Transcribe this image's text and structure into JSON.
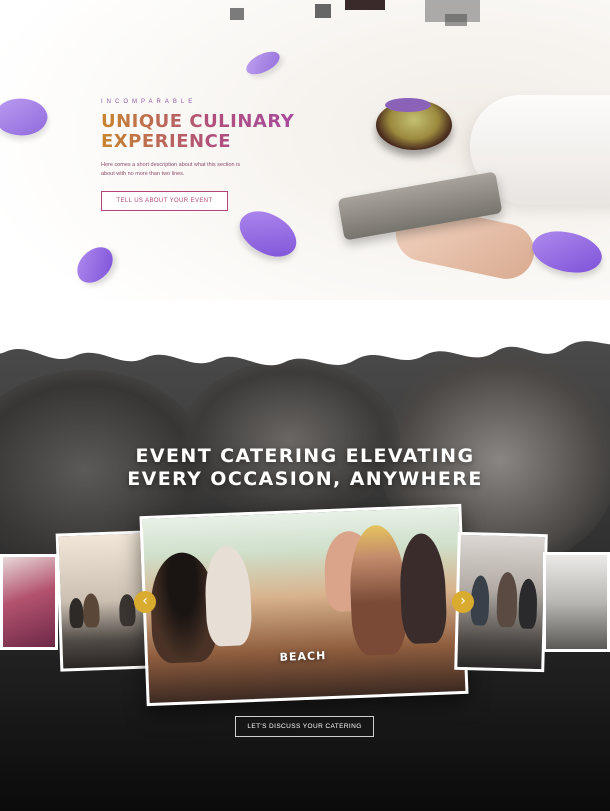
{
  "hero": {
    "eyebrow": "INCOMPARABLE",
    "title_line1": "UNIQUE CULINARY",
    "title_line2": "EXPERIENCE",
    "description": "Here comes a short description about what this section is about with no more than two lines.",
    "cta_label": "TELL US ABOUT YOUR EVENT"
  },
  "events": {
    "title_line1": "EVENT CATERING ELEVATING",
    "title_line2": "EVERY OCCASION, ANYWHERE",
    "active_slide_label": "BEACH",
    "prev_icon": "chevron-left-icon",
    "next_icon": "chevron-right-icon",
    "cta_label": "LET'S DISCUSS YOUR CATERING"
  },
  "colors": {
    "accent_gold": "#d9ab2f",
    "accent_magenta": "#b24575",
    "accent_purple": "#8e5aa6"
  }
}
